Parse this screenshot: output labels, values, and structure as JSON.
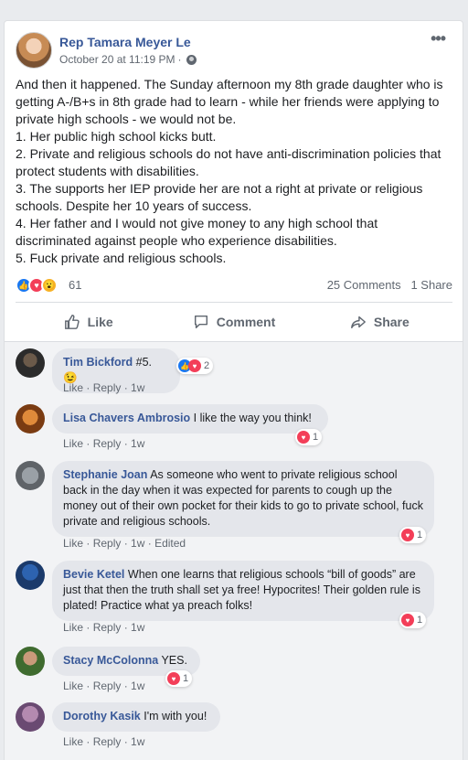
{
  "post": {
    "author": "Rep Tamara Meyer Le",
    "timestamp": "October 20 at 11:19 PM",
    "separator": "·",
    "more_label": "•••",
    "body": [
      "And then it happened. The Sunday afternoon my 8th grade daughter who is getting A-/B+s in 8th grade had to learn - while her friends were applying to private high schools - we would not be.",
      "1. Her public high school kicks butt.",
      "2. Private and religious schools do not have anti-discrimination policies that protect students with disabilities.",
      "3. The supports her IEP provide her are not a right at private or religious schools. Despite her 10 years of success.",
      "4. Her father and I would not give money to any high school that discriminated against people who experience disabilities.",
      "5. Fuck private and religious schools."
    ],
    "reaction_count": "61",
    "comments_count": "25 Comments",
    "shares_count": "1 Share"
  },
  "actions": {
    "like": "Like",
    "comment": "Comment",
    "share": "Share"
  },
  "comment_links": {
    "like": "Like",
    "reply": "Reply",
    "sep": " · "
  },
  "comments": [
    {
      "name": "Tim Bickford",
      "text": "#5. 😉",
      "time": "1w",
      "reactions": "2",
      "edited": ""
    },
    {
      "name": "Lisa Chavers Ambrosio",
      "text": "I like the way you think!",
      "time": "1w",
      "reactions": "1",
      "edited": ""
    },
    {
      "name": "Stephanie Joan",
      "text": "As someone who went to private religious school back in the day when it was expected for parents to cough up the money out of their own pocket for their kids to go to private school, fuck private and religious schools.",
      "time": "1w",
      "reactions": "1",
      "edited": "Edited"
    },
    {
      "name": "Bevie Ketel",
      "text": "When one learns that religious schools “bill of goods” are just that then the truth shall set ya free! Hypocrites! Their golden rule is plated! Practice what ya preach folks!",
      "time": "1w",
      "reactions": "1",
      "edited": ""
    },
    {
      "name": "Stacy McColonna",
      "text": "YES.",
      "time": "1w",
      "reactions": "1",
      "edited": ""
    },
    {
      "name": "Dorothy Kasik",
      "text": "I'm with you!",
      "time": "1w",
      "reactions": "",
      "edited": ""
    }
  ],
  "colors": {
    "link": "#385898",
    "like_blue": "#1877f2",
    "love_red": "#f33e58"
  }
}
